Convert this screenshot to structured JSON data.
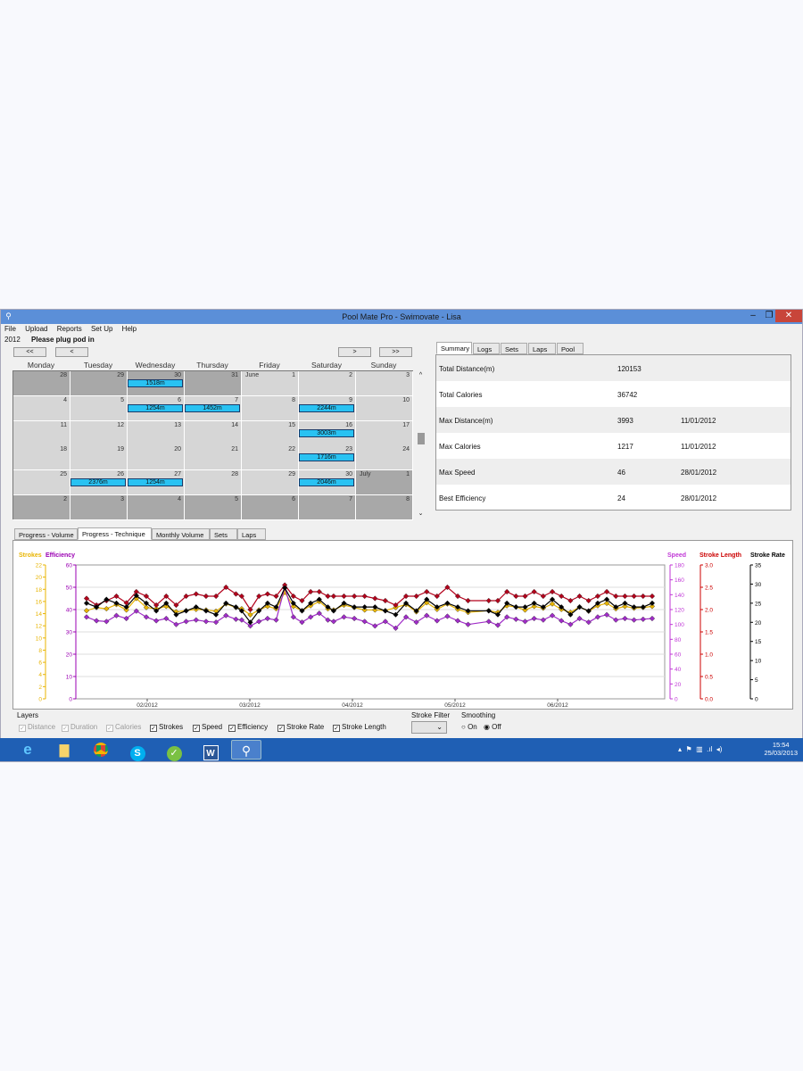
{
  "window": {
    "title": "Pool Mate Pro - Swimovate - Lisa",
    "min": "–",
    "restore": "❐",
    "close": "✕"
  },
  "menu": [
    "File",
    "Upload",
    "Reports",
    "Set Up",
    "Help"
  ],
  "status": {
    "year": "2012",
    "message": "Please plug pod in"
  },
  "nav": {
    "first": "<<",
    "prev": "<",
    "next": ">",
    "last": ">>"
  },
  "days": [
    "Monday",
    "Tuesday",
    "Wednesday",
    "Thursday",
    "Friday",
    "Saturday",
    "Sunday"
  ],
  "calendar": [
    [
      {
        "d": "28",
        "dim": true
      },
      {
        "d": "29",
        "dim": true
      },
      {
        "d": "30",
        "dim": true,
        "b": "1518m"
      },
      {
        "d": "31",
        "dim": true
      },
      {
        "d": "1",
        "m": "June"
      },
      {
        "d": "2"
      },
      {
        "d": "3"
      }
    ],
    [
      {
        "d": "4"
      },
      {
        "d": "5"
      },
      {
        "d": "6",
        "b": "1254m"
      },
      {
        "d": "7",
        "b": "1452m"
      },
      {
        "d": "8"
      },
      {
        "d": "9",
        "b": "2244m"
      },
      {
        "d": "10"
      }
    ],
    [
      {
        "d": "11"
      },
      {
        "d": "12"
      },
      {
        "d": "13"
      },
      {
        "d": "14"
      },
      {
        "d": "15"
      },
      {
        "d": "16",
        "b": "3003m"
      },
      {
        "d": "17"
      }
    ],
    [
      {
        "d": "18"
      },
      {
        "d": "19"
      },
      {
        "d": "20"
      },
      {
        "d": "21"
      },
      {
        "d": "22"
      },
      {
        "d": "23",
        "b": "1716m"
      },
      {
        "d": "24"
      }
    ],
    [
      {
        "d": "25"
      },
      {
        "d": "26",
        "b": "2376m"
      },
      {
        "d": "27",
        "b": "1254m"
      },
      {
        "d": "28"
      },
      {
        "d": "29"
      },
      {
        "d": "30",
        "b": "2046m"
      },
      {
        "d": "1",
        "m": "July",
        "dim": true
      }
    ],
    [
      {
        "d": "2",
        "dim": true
      },
      {
        "d": "3",
        "dim": true
      },
      {
        "d": "4",
        "dim": true
      },
      {
        "d": "5",
        "dim": true
      },
      {
        "d": "6",
        "dim": true
      },
      {
        "d": "7",
        "dim": true
      },
      {
        "d": "8",
        "dim": true
      }
    ]
  ],
  "summary_tabs": [
    "Summary",
    "Logs",
    "Sets",
    "Laps",
    "Pool"
  ],
  "summary": [
    {
      "label": "Total Distance(m)",
      "value": "120153",
      "date": ""
    },
    {
      "label": "Total Calories",
      "value": "36742",
      "date": ""
    },
    {
      "label": "Max Distance(m)",
      "value": "3993",
      "date": "11/01/2012"
    },
    {
      "label": "Max Calories",
      "value": "1217",
      "date": "11/01/2012"
    },
    {
      "label": "Max Speed",
      "value": "46",
      "date": "28/01/2012"
    },
    {
      "label": "Best Efficiency",
      "value": "24",
      "date": "28/01/2012"
    }
  ],
  "chart_tabs": [
    "Progress - Volume",
    "Progress - Technique",
    "Monthly Volume",
    "Sets",
    "Laps"
  ],
  "layers": {
    "title": "Layers",
    "items": [
      {
        "label": "Distance",
        "checked": true,
        "disabled": true
      },
      {
        "label": "Duration",
        "checked": true,
        "disabled": true
      },
      {
        "label": "Calories",
        "checked": true,
        "disabled": true
      },
      {
        "label": "Strokes",
        "checked": true,
        "disabled": false
      },
      {
        "label": "Speed",
        "checked": true,
        "disabled": false
      },
      {
        "label": "Efficiency",
        "checked": true,
        "disabled": false
      },
      {
        "label": "Stroke Rate",
        "checked": true,
        "disabled": false
      },
      {
        "label": "Stroke Length",
        "checked": true,
        "disabled": false
      }
    ],
    "stroke_filter": "Stroke Filter",
    "smoothing": "Smoothing",
    "on": "On",
    "off": "Off"
  },
  "taskbar": {
    "time": "15:54",
    "date": "25/03/2013"
  },
  "chart_data": {
    "type": "line",
    "x_ticks": [
      "02/2012",
      "03/2012",
      "04/2012",
      "05/2012",
      "06/2012"
    ],
    "axes": {
      "strokes": {
        "label": "Strokes",
        "color": "#e8b400",
        "ylim": [
          0,
          22
        ],
        "ticks": [
          "0",
          "2",
          "4",
          "6",
          "8",
          "10",
          "12",
          "14",
          "16",
          "18",
          "20",
          "22"
        ]
      },
      "efficiency": {
        "label": "Efficiency",
        "color": "#9b00b3",
        "ylim": [
          0,
          60
        ],
        "ticks": [
          "0",
          "10",
          "20",
          "30",
          "40",
          "50",
          "60"
        ]
      },
      "speed": {
        "label": "Speed",
        "color": "#c037d6",
        "ylim": [
          0,
          180
        ],
        "ticks": [
          "0",
          "20",
          "40",
          "60",
          "80",
          "100",
          "120",
          "140",
          "160",
          "180"
        ]
      },
      "stroke_length": {
        "label": "Stroke Length",
        "color": "#cc0000",
        "ylim": [
          0,
          3.0
        ],
        "ticks": [
          "0.0",
          "0.5",
          "1.0",
          "1.5",
          "2.0",
          "2.5",
          "3.0"
        ]
      },
      "stroke_rate": {
        "label": "Stroke Rate",
        "color": "#000000",
        "ylim": [
          0,
          35
        ],
        "ticks": [
          "0",
          "5",
          "10",
          "15",
          "20",
          "25",
          "30",
          "35"
        ]
      }
    },
    "series": [
      {
        "name": "Strokes",
        "color": "#e8b400",
        "axis": "strokes",
        "values": [
          14.5,
          15,
          14.8,
          15.5,
          14.6,
          16.5,
          15,
          14.8,
          15.2,
          14.3,
          14.5,
          14.7,
          14.6,
          14.4,
          15.6,
          15,
          14.8,
          13.8,
          14.6,
          15.2,
          14.8,
          17.5,
          15.2,
          14.5,
          15.3,
          16,
          14.8,
          14.6,
          15.4,
          15,
          14.6,
          14.6,
          14.5,
          15,
          15.5,
          14.3,
          15.8,
          14.7,
          15.6,
          14.7,
          14.2,
          14.5,
          14.2,
          15.3,
          15.1,
          14.6,
          15.2,
          14.9,
          15.6,
          14.7,
          14.2,
          15.1,
          14.4,
          15.3,
          15.7,
          14.8,
          15.2,
          14.9,
          15.0,
          15.2
        ]
      },
      {
        "name": "Speed",
        "color": "#a02cc8",
        "axis": "speed",
        "values": [
          110,
          105,
          104,
          112,
          108,
          118,
          110,
          105,
          108,
          100,
          104,
          106,
          104,
          103,
          112,
          107,
          106,
          98,
          104,
          108,
          106,
          150,
          110,
          103,
          110,
          115,
          106,
          104,
          110,
          108,
          104,
          98,
          104,
          95,
          110,
          103,
          112,
          105,
          111,
          105,
          100,
          104,
          99,
          110,
          107,
          104,
          108,
          106,
          112,
          105,
          100,
          108,
          103,
          110,
          113,
          106,
          108,
          106,
          107,
          108
        ]
      },
      {
        "name": "Stroke Length",
        "color": "#b3001b",
        "axis": "stroke_length",
        "values": [
          2.25,
          2.1,
          2.2,
          2.3,
          2.15,
          2.4,
          2.3,
          2.1,
          2.3,
          2.1,
          2.3,
          2.35,
          2.3,
          2.3,
          2.5,
          2.35,
          2.3,
          2.0,
          2.3,
          2.35,
          2.3,
          2.55,
          2.3,
          2.2,
          2.4,
          2.4,
          2.3,
          2.3,
          2.3,
          2.3,
          2.3,
          2.25,
          2.2,
          2.1,
          2.3,
          2.3,
          2.4,
          2.3,
          2.5,
          2.3,
          2.2,
          2.2,
          2.2,
          2.4,
          2.3,
          2.3,
          2.4,
          2.3,
          2.4,
          2.3,
          2.2,
          2.3,
          2.2,
          2.3,
          2.4,
          2.3,
          2.3,
          2.3,
          2.3,
          2.3
        ]
      },
      {
        "name": "Stroke Rate",
        "color": "#000000",
        "axis": "stroke_rate",
        "values": [
          25,
          24,
          26,
          25,
          24,
          27,
          25,
          23,
          25,
          22,
          23,
          24,
          23,
          22,
          25,
          24,
          23,
          20,
          23,
          25,
          24,
          29,
          25,
          23,
          25,
          26,
          24,
          23,
          25,
          24,
          24,
          24,
          23,
          22,
          25,
          23,
          26,
          24,
          25,
          24,
          23,
          23,
          22,
          25,
          24,
          24,
          25,
          24,
          26,
          24,
          22,
          24,
          23,
          25,
          26,
          24,
          25,
          24,
          24,
          25
        ]
      }
    ]
  }
}
